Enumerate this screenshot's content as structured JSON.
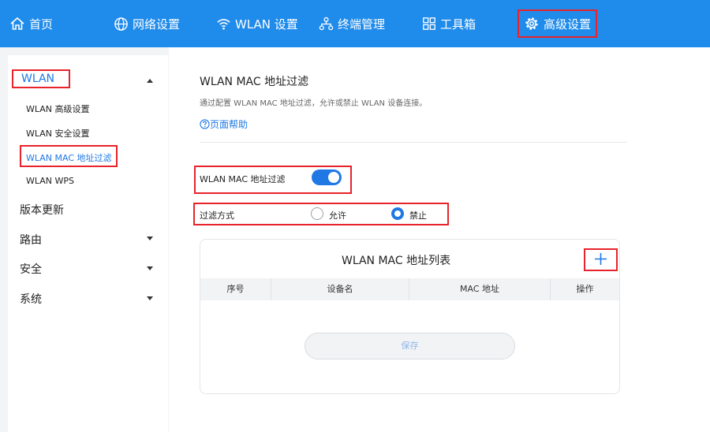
{
  "topnav": {
    "items": [
      {
        "label": "首页",
        "icon": "home-icon"
      },
      {
        "label": "网络设置",
        "icon": "globe-icon"
      },
      {
        "label": "WLAN 设置",
        "icon": "wifi-icon"
      },
      {
        "label": "终端管理",
        "icon": "devices-tree-icon"
      },
      {
        "label": "工具箱",
        "icon": "grid-icon"
      },
      {
        "label": "高级设置",
        "icon": "gear-icon"
      }
    ],
    "active": "高级设置"
  },
  "sidebar": {
    "wlan": {
      "label": "WLAN",
      "items": [
        "WLAN 高级设置",
        "WLAN 安全设置",
        "WLAN MAC 地址过滤",
        "WLAN WPS"
      ]
    },
    "groups": [
      "版本更新",
      "路由",
      "安全",
      "系统"
    ]
  },
  "main": {
    "title": "WLAN MAC 地址过滤",
    "description": "通过配置 WLAN MAC 地址过滤，允许或禁止 WLAN 设备连接。",
    "help_link": "页面帮助",
    "filter_label": "WLAN MAC 地址过滤",
    "filter_enabled": true,
    "mode_label": "过滤方式",
    "mode_allow": "允许",
    "mode_deny": "禁止",
    "mode_selected": "禁止",
    "table": {
      "title": "WLAN MAC 地址列表",
      "columns": [
        "序号",
        "设备名",
        "MAC 地址",
        "操作"
      ]
    },
    "save_label": "保存"
  },
  "colors": {
    "accent": "#1f8bea",
    "highlight": "#e8232b"
  }
}
